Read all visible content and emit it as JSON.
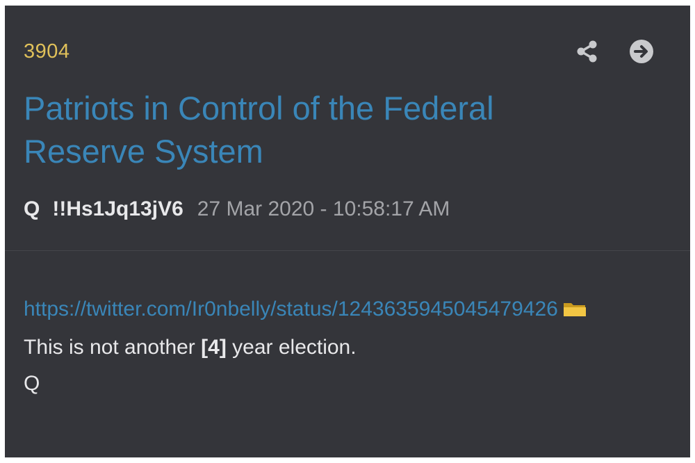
{
  "post": {
    "number": "3904",
    "title": "Patriots in Control of the Federal Reserve System",
    "author": "Q",
    "tripcode": "!!Hs1Jq13jV6",
    "timestamp": "27 Mar 2020 - 10:58:17 AM",
    "link": "https://twitter.com/Ir0nbelly/status/1243635945045479426",
    "message_prefix": "This is not another ",
    "message_bold": "[4]",
    "message_suffix": " year election.",
    "signature": "Q"
  },
  "icons": {
    "share": "share-icon",
    "open": "arrow-right-circle-icon",
    "folder": "folder-icon"
  },
  "colors": {
    "background": "#34353a",
    "post_number": "#e0c15a",
    "link": "#3a86b8",
    "text": "#e8e8ea",
    "muted": "#a3a4a8",
    "icon": "#c9cacd",
    "folder": "#f2c644"
  }
}
